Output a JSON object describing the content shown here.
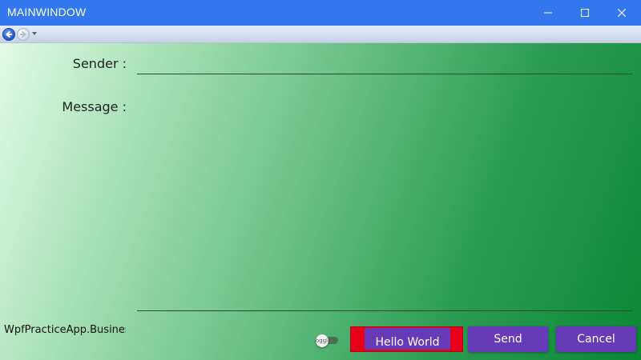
{
  "window": {
    "title": "MAINWINDOW",
    "minimize_icon": "minimize-icon",
    "maximize_icon": "maximize-icon",
    "close_icon": "close-icon",
    "titlebar_color": "#3478f0"
  },
  "navigation": {
    "back_icon": "back-arrow-icon",
    "forward_icon": "forward-arrow-icon",
    "history_icon": "chevron-down-icon"
  },
  "form": {
    "sender_label": "Sender :",
    "sender_value": "",
    "message_label": "Message :",
    "message_value": ""
  },
  "status": {
    "business_logic_text": "WpfPracticeApp.BusinessLogic"
  },
  "toggle": {
    "label": "Toggle",
    "checked": false
  },
  "buttons": {
    "hello_label": "Hello World",
    "send_label": "Send",
    "cancel_label": "Cancel",
    "accent_color": "#673ab7",
    "highlight_color": "#e8001a"
  }
}
